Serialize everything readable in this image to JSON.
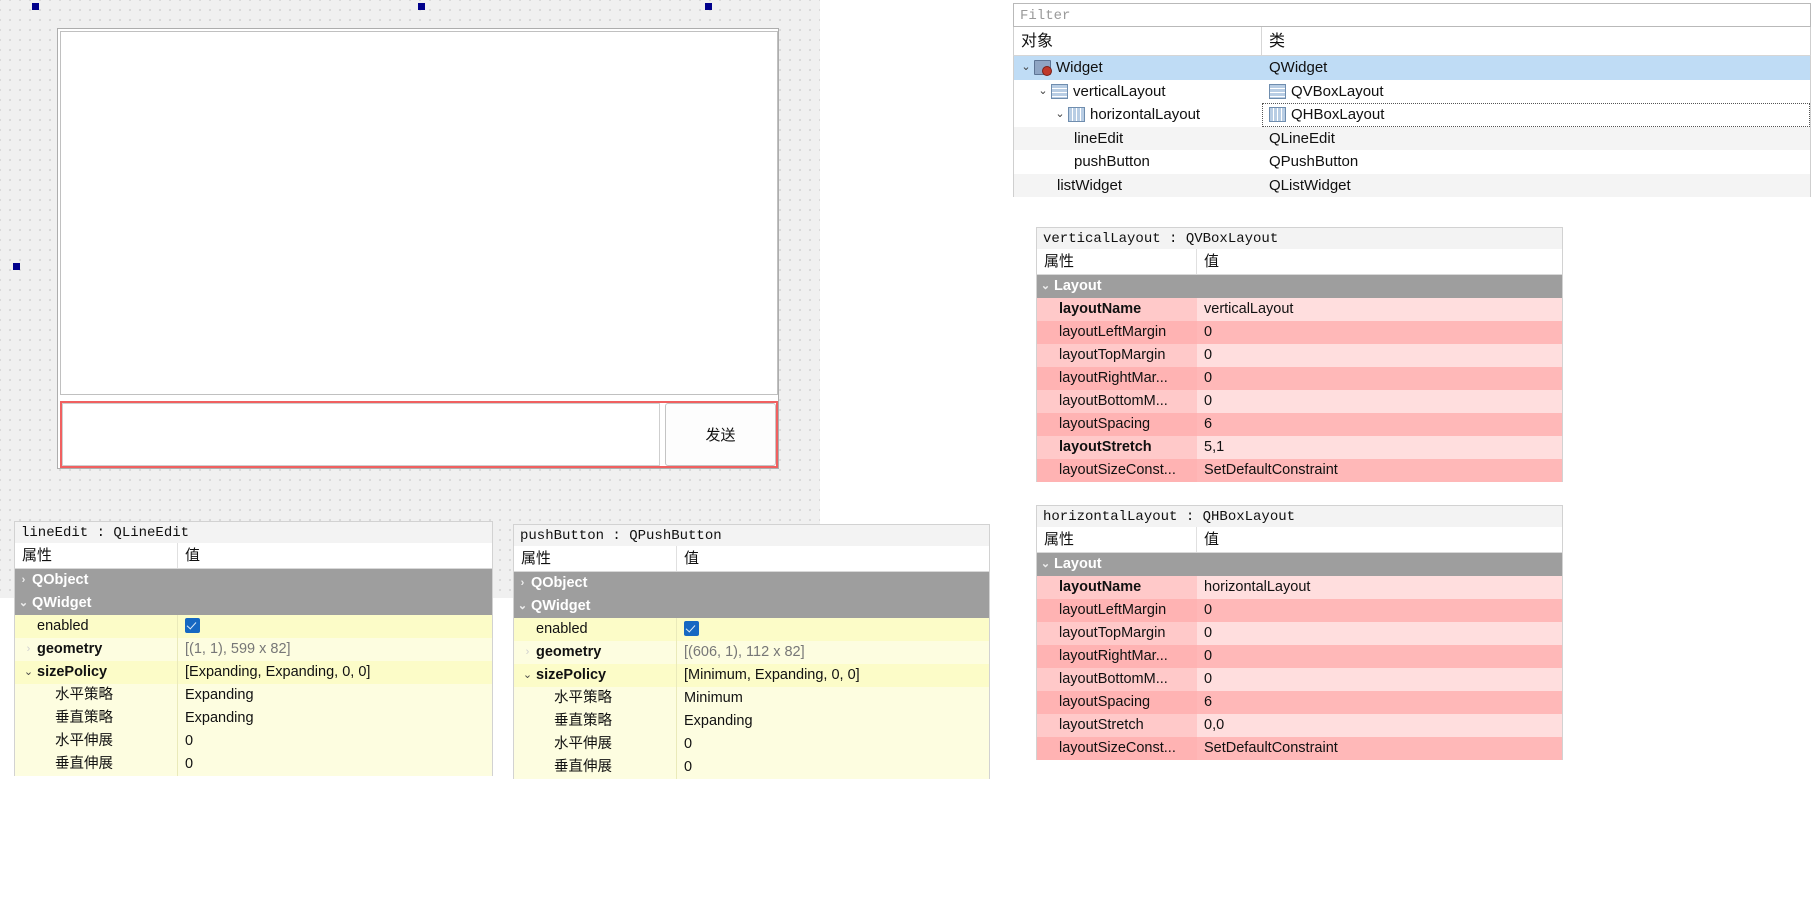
{
  "canvas": {
    "push_button_text": "发送",
    "selection_color": "#f06060"
  },
  "inspector": {
    "filter_placeholder": "Filter",
    "columns": {
      "object": "对象",
      "class": "类"
    },
    "rows": [
      {
        "name": "Widget",
        "class": "QWidget",
        "icon": "widget-icon",
        "depth": 0,
        "expanded": true,
        "selected": true
      },
      {
        "name": "verticalLayout",
        "class": "QVBoxLayout",
        "icon": "vbox-layout-icon",
        "depth": 1,
        "expanded": true,
        "selected": false
      },
      {
        "name": "horizontalLayout",
        "class": "QHBoxLayout",
        "icon": "hbox-layout-icon",
        "depth": 2,
        "expanded": true,
        "selected": false
      },
      {
        "name": "lineEdit",
        "class": "QLineEdit",
        "icon": "none",
        "depth": 3,
        "expanded": false,
        "selected": false
      },
      {
        "name": "pushButton",
        "class": "QPushButton",
        "icon": "none",
        "depth": 3,
        "expanded": false,
        "selected": false
      },
      {
        "name": "listWidget",
        "class": "QListWidget",
        "icon": "none",
        "depth": 2,
        "expanded": false,
        "selected": false
      }
    ]
  },
  "common": {
    "col_property": "属性",
    "col_value": "值",
    "group_layout": "Layout",
    "group_qobject": "QObject",
    "group_qwidget": "QWidget",
    "label_h_policy": "水平策略",
    "label_v_policy": "垂直策略",
    "label_h_stretch": "水平伸展",
    "label_v_stretch": "垂直伸展"
  },
  "panel_vlayout": {
    "title": "verticalLayout : QVBoxLayout",
    "rows": [
      {
        "key": "layoutName",
        "value": "verticalLayout",
        "bold": true
      },
      {
        "key": "layoutLeftMargin",
        "value": "0",
        "bold": false
      },
      {
        "key": "layoutTopMargin",
        "value": "0",
        "bold": false
      },
      {
        "key": "layoutRightMar...",
        "value": "0",
        "bold": false
      },
      {
        "key": "layoutBottomM...",
        "value": "0",
        "bold": false
      },
      {
        "key": "layoutSpacing",
        "value": "6",
        "bold": false
      },
      {
        "key": "layoutStretch",
        "value": "5,1",
        "bold": true
      },
      {
        "key": "layoutSizeConst...",
        "value": "SetDefaultConstraint",
        "bold": false
      }
    ]
  },
  "panel_hlayout": {
    "title": "horizontalLayout : QHBoxLayout",
    "rows": [
      {
        "key": "layoutName",
        "value": "horizontalLayout",
        "bold": true
      },
      {
        "key": "layoutLeftMargin",
        "value": "0",
        "bold": false
      },
      {
        "key": "layoutTopMargin",
        "value": "0",
        "bold": false
      },
      {
        "key": "layoutRightMar...",
        "value": "0",
        "bold": false
      },
      {
        "key": "layoutBottomM...",
        "value": "0",
        "bold": false
      },
      {
        "key": "layoutSpacing",
        "value": "6",
        "bold": false
      },
      {
        "key": "layoutStretch",
        "value": "0,0",
        "bold": false
      },
      {
        "key": "layoutSizeConst...",
        "value": "SetDefaultConstraint",
        "bold": false
      }
    ]
  },
  "panel_lineedit": {
    "title": "lineEdit : QLineEdit",
    "enabled_key": "enabled",
    "geometry_key": "geometry",
    "geometry_value": "[(1, 1), 599 x 82]",
    "sizepolicy_key": "sizePolicy",
    "sizepolicy_value": "[Expanding, Expanding, 0, 0]",
    "h_policy": "Expanding",
    "v_policy": "Expanding",
    "h_stretch": "0",
    "v_stretch": "0"
  },
  "panel_pushbutton": {
    "title": "pushButton : QPushButton",
    "enabled_key": "enabled",
    "geometry_key": "geometry",
    "geometry_value": "[(606, 1), 112 x 82]",
    "sizepolicy_key": "sizePolicy",
    "sizepolicy_value": "[Minimum, Expanding, 0, 0]",
    "h_policy": "Minimum",
    "v_policy": "Expanding",
    "h_stretch": "0",
    "v_stretch": "0"
  }
}
